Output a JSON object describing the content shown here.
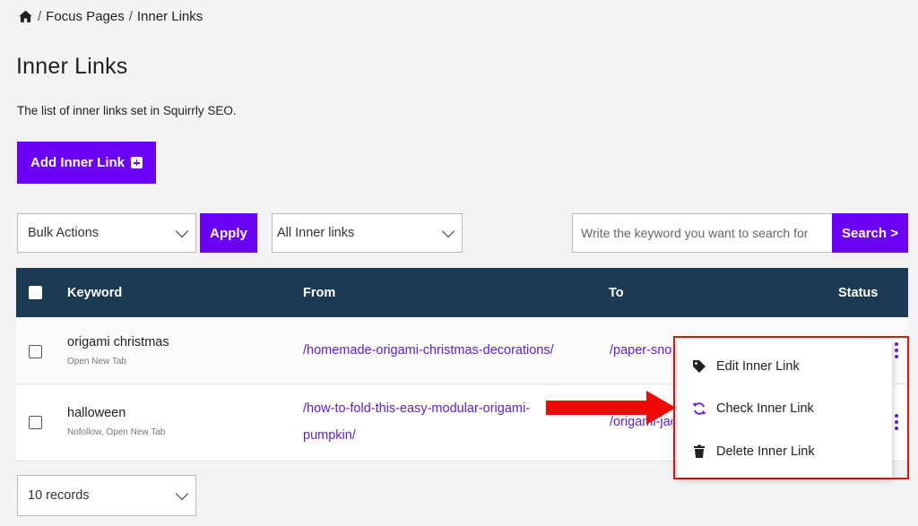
{
  "breadcrumb": {
    "home_icon": "home-icon",
    "separator": "/",
    "items": [
      "Focus Pages",
      "Inner Links"
    ]
  },
  "page": {
    "title": "Inner Links",
    "description": "The list of inner links set in Squirrly SEO."
  },
  "toolbar": {
    "add_label": "Add Inner Link",
    "bulk_actions": "Bulk Actions",
    "apply_label": "Apply",
    "filter_value": "All Inner links",
    "search_placeholder": "Write the keyword you want to search for",
    "search_label": "Search >"
  },
  "table": {
    "headers": {
      "keyword": "Keyword",
      "from": "From",
      "to": "To",
      "status": "Status"
    },
    "rows": [
      {
        "keyword": "origami christmas",
        "options": "Open New Tab",
        "from": "/homemade-origami-christmas-decorations/",
        "to": "/paper-snowflakes/"
      },
      {
        "keyword": "halloween",
        "options": "Nofollow, Open New Tab",
        "from_line1": "/how-to-fold-this-easy-modular-origami-",
        "from_line2": "pumpkin/",
        "to": "/origami-jack-o-lantern/"
      }
    ]
  },
  "pagination": {
    "records_value": "10 records"
  },
  "row_menu": {
    "items": [
      {
        "label": "Edit Inner Link",
        "icon": "tag-icon"
      },
      {
        "label": "Check Inner Link",
        "icon": "refresh-icon"
      },
      {
        "label": "Delete Inner Link",
        "icon": "trash-icon"
      }
    ]
  },
  "colors": {
    "primary": "#6a00f4",
    "table_header": "#1c3a52",
    "link": "#5a1fc8",
    "highlight": "#e8140c"
  }
}
